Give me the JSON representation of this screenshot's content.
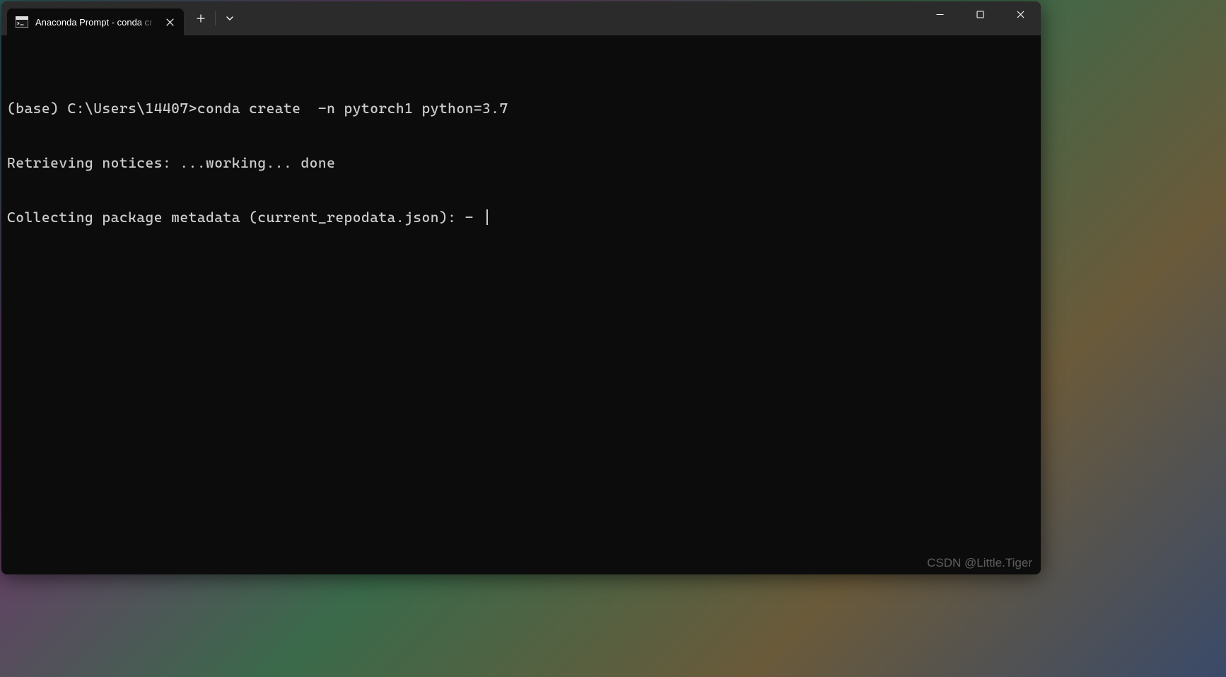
{
  "window": {
    "tab_title": "Anaconda Prompt - conda  cr",
    "watermark": "CSDN @Little.Tiger"
  },
  "terminal": {
    "lines": [
      "(base) C:\\Users\\14407>conda create  -n pytorch1 python=3.7",
      "Retrieving notices: ...working... done",
      "Collecting package metadata (current_repodata.json): - "
    ]
  }
}
